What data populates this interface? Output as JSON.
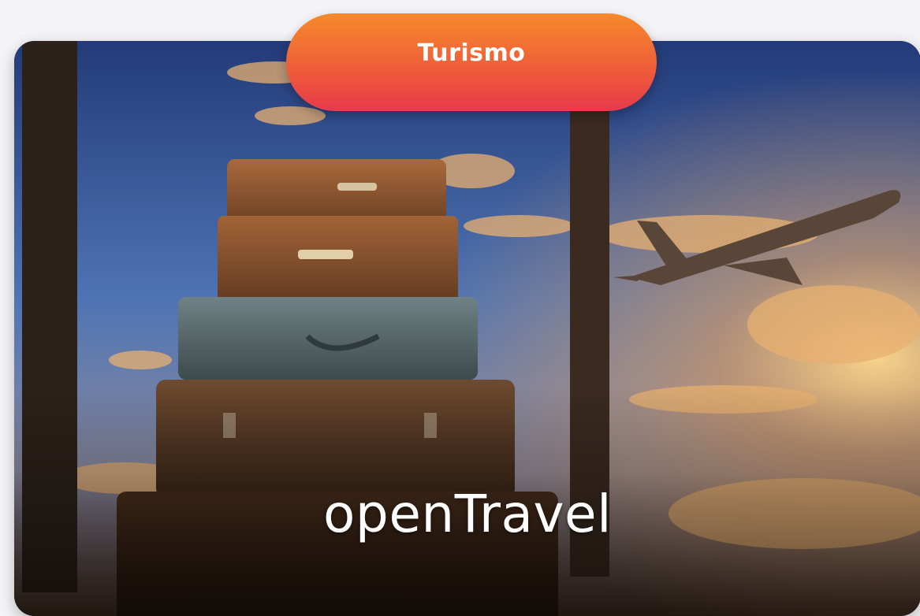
{
  "category": {
    "label": "Turismo"
  },
  "card": {
    "title": "openTravel"
  },
  "colors": {
    "pill_top": "#f58a2b",
    "pill_bottom": "#e83a4c",
    "text": "#ffffff"
  }
}
